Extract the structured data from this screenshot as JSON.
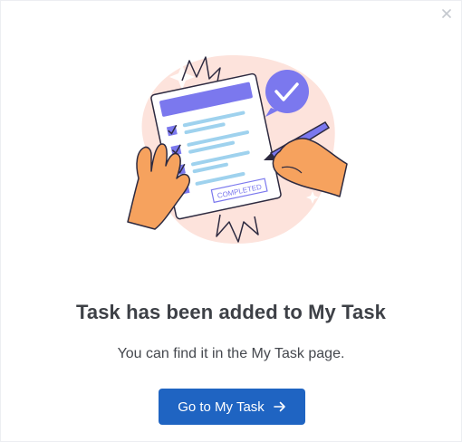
{
  "dialog": {
    "title": "Task has been added to My Task",
    "message": "You can find it in the My Task page.",
    "primary_button_label": "Go to My Task",
    "close_icon": "close-icon",
    "button_icon": "arrow-right-icon",
    "stamp_text": "COMPLETED"
  },
  "colors": {
    "primary": "#1f64c2",
    "title_text": "#3d4046",
    "body_text": "#45484e",
    "illustration_accent": "#7b78ee",
    "illustration_blob": "#fde3dc",
    "skin": "#f6a25e"
  }
}
